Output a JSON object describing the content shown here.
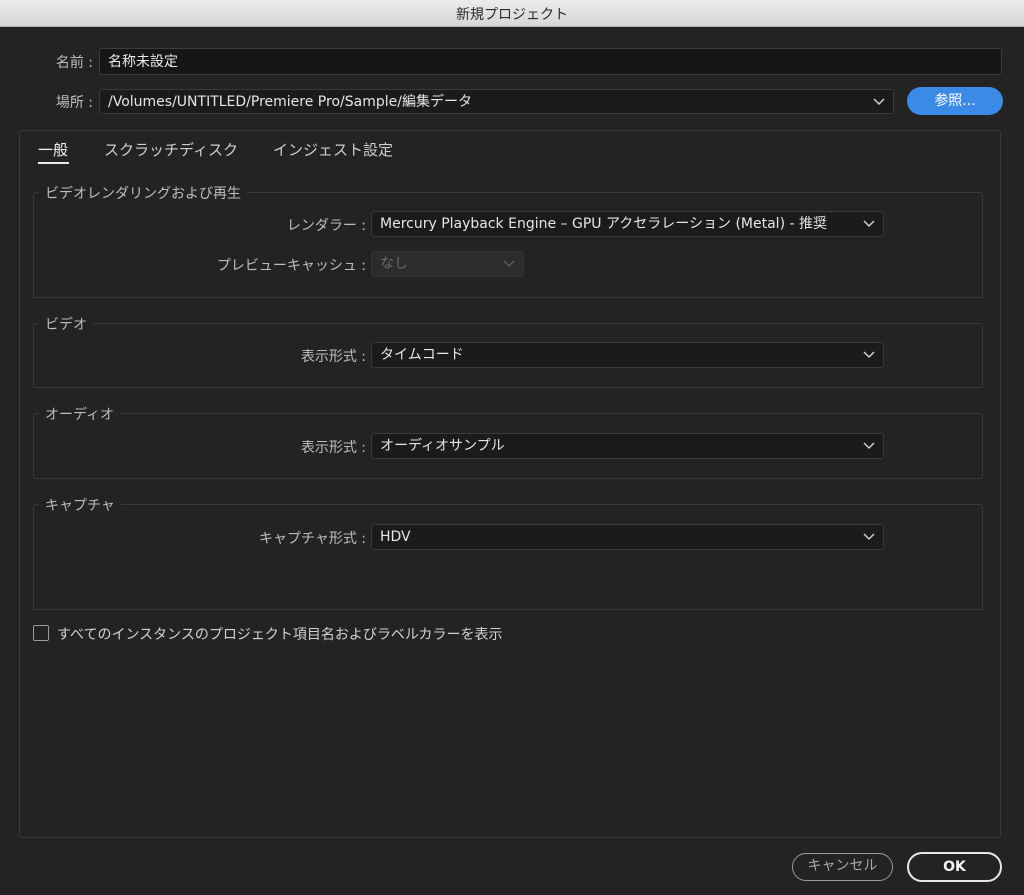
{
  "window": {
    "title": "新規プロジェクト"
  },
  "name": {
    "label": "名前 :",
    "value": "名称未設定"
  },
  "location": {
    "label": "場所 :",
    "value": "/Volumes/UNTITLED/Premiere Pro/Sample/編集データ",
    "browse_label": "参照..."
  },
  "tabs": [
    {
      "label": "一般",
      "active": true
    },
    {
      "label": "スクラッチディスク",
      "active": false
    },
    {
      "label": "インジェスト設定",
      "active": false
    }
  ],
  "video_rendering": {
    "title": "ビデオレンダリングおよび再生",
    "renderer_label": "レンダラー :",
    "renderer_value": "Mercury Playback Engine – GPU アクセラレーション (Metal) - 推奨",
    "preview_cache_label": "プレビューキャッシュ :",
    "preview_cache_value": "なし"
  },
  "video": {
    "title": "ビデオ",
    "display_format_label": "表示形式 :",
    "display_format_value": "タイムコード"
  },
  "audio": {
    "title": "オーディオ",
    "display_format_label": "表示形式 :",
    "display_format_value": "オーディオサンプル"
  },
  "capture": {
    "title": "キャプチャ",
    "capture_format_label": "キャプチャ形式 :",
    "capture_format_value": "HDV"
  },
  "checkbox": {
    "label": "すべてのインスタンスのプロジェクト項目名およびラベルカラーを表示",
    "checked": false
  },
  "buttons": {
    "cancel": "キャンセル",
    "ok": "OK"
  },
  "colors": {
    "background": "#232323",
    "accent": "#3b8be6",
    "titlebar": "#d6d6d6"
  }
}
